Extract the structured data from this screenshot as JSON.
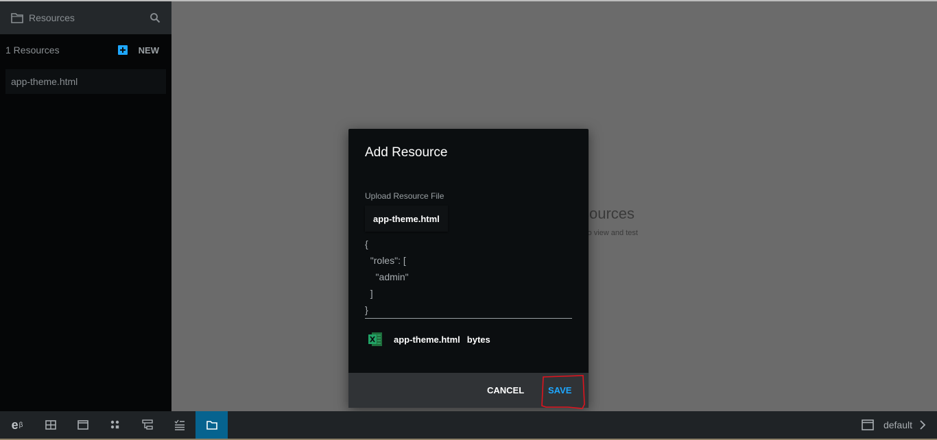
{
  "sidebar": {
    "title": "Resources",
    "count_label": "1 Resources",
    "new_label": "NEW",
    "items": [
      {
        "label": "app-theme.html"
      }
    ]
  },
  "background": {
    "title_fragment": "sources",
    "sub_fragment": "l to view and test"
  },
  "dialog": {
    "title": "Add Resource",
    "upload_label": "Upload Resource File",
    "file_button_label": "app-theme.html",
    "code": "{\n  \"roles\": [\n    \"admin\"\n  ]\n}",
    "file_name": "app-theme.html",
    "file_size": "bytes",
    "cancel_label": "CANCEL",
    "save_label": "SAVE"
  },
  "bottombar": {
    "logo": "e",
    "logo_sup": "β",
    "buttons": [
      {
        "icon": "grid-icon"
      },
      {
        "icon": "window-icon"
      },
      {
        "icon": "components-icon"
      },
      {
        "icon": "flow-icon"
      },
      {
        "icon": "tests-icon"
      },
      {
        "icon": "folder-icon",
        "active": true
      }
    ],
    "environment": "default"
  },
  "colors": {
    "accent": "#1ea7ff",
    "active_tab": "#06638f",
    "annotation": "#e0141e"
  }
}
